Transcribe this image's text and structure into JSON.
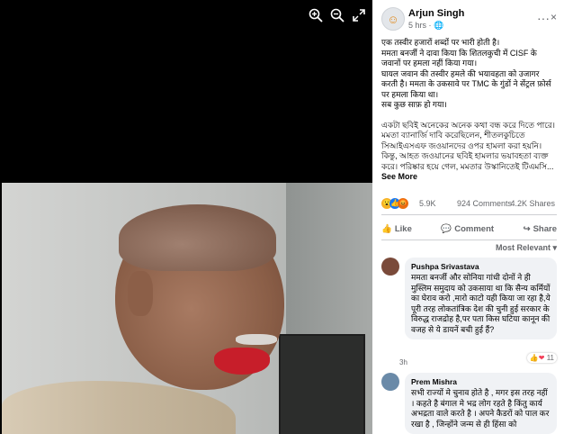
{
  "viewer": {
    "controls": [
      "zoom-in-icon",
      "zoom-out-icon",
      "fullscreen-icon"
    ]
  },
  "post": {
    "author": "Arjun Singh",
    "time": "5 hrs",
    "privacy_icon": "globe-icon",
    "text_lines": [
      "एक तस्वीर हजारों शब्दों पर भारी होती है।",
      "ममता बनर्जी ने दावा किया कि शितलकुची में CISF के जवानों पर हमला नहीं किया गया।",
      "घायल जवान की तस्वीर हमले की भयावहता को उजागर करती है। ममता के उकसावे पर TMC के गुंडों ने सेंट्रल फ़ोर्स पर हमला किया था।",
      "सब कुछ साफ़ हो गया।"
    ],
    "text_lines_2": [
      "একটা ছবিই অনেকের অনেক কথা বন্ধ করে দিতে পারে।",
      "মমতা ব্যানার্জি দাবি করেছিলেন, শীতলকুচিতে সিআইএসএফ জওয়ানদের ওপর হামলা করা হয়নি। কিন্তু, আহত জওয়ানের ছবিই হামলার ভয়াবহতা ব্যক্ত করে। পরিষ্কার হয়ে গেল, মমতার উস্কানিতেই টিএমসি..."
    ],
    "see_more": "See More",
    "reactions_count": "5.9K",
    "comments_count": "924 Comments",
    "shares_count": "4.2K Shares",
    "actions": {
      "like": "Like",
      "comment": "Comment",
      "share": "Share"
    },
    "sort_label": "Most Relevant ▾"
  },
  "comments": [
    {
      "name": "Pushpa Srivastava",
      "text": "ममता बनर्जी और सोनिया गांधी दोनों ने ही मुस्लिम समुदाय को उकसाया था कि सैन्य कर्मियों का घेराव करो ,मारो काटो यही किया जा रहा है,ये पूरी तरह लोकतांत्रिक देश की चुनी हुई सरकार के विरुद्ध राजद्रोह है,पर पता किस घटिया कानून की वजह से ये डायनें बची हुई हैं?",
      "time": "3h",
      "react_count": "11"
    },
    {
      "name": "Prem Mishra",
      "text": "सभी राज्यों मे चुनाव होते है , मगर इस तरह नहीं । कहते है बंगाल मे भद्र लोग रहते है किंतु कार्य अभद्रता वाले करते है । अपने कैडरों को पाल कर रखा है , जिन्होंने जन्म से ही हिंसा को",
      "time": "",
      "react_count": ""
    }
  ],
  "colors": {
    "like_blue": "#1877f2",
    "love_red": "#f33e58",
    "angry_orange": "#f7b125",
    "text_gray": "#65676b"
  }
}
